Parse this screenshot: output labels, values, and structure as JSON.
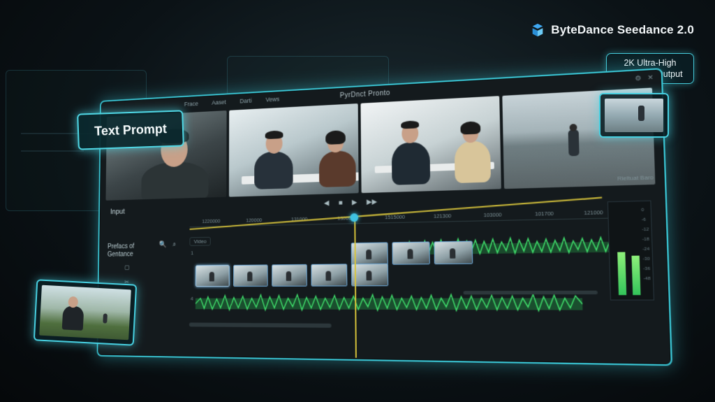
{
  "brand": {
    "name": "ByteDance Seedance 2.0",
    "icon": "seedance-logo-icon"
  },
  "badge": {
    "line1": "2K Ultra-High",
    "line2": "Definition Output"
  },
  "editor": {
    "title": "PyrDnct Pronto",
    "menu": [
      "Frace",
      "Aaset",
      "Darti",
      "Vews"
    ],
    "input_label": "Input",
    "preface_label": "Prefacs of",
    "preface_sub": "Gentance",
    "preview_label": "Rieltuat Baro",
    "ruler_ticks": [
      "1220000",
      "120000",
      "131000",
      "130000",
      "1515000",
      "121300",
      "103000",
      "101700",
      "121000"
    ],
    "track_header": "Video",
    "track_numbers": [
      "1",
      "4"
    ],
    "controls": [
      "◀",
      "■",
      "▶",
      "▶▶"
    ],
    "tools": [
      "🔍",
      "⌕"
    ],
    "meter_marks": [
      "0",
      "-6",
      "-12",
      "-18",
      "-24",
      "-30",
      "-36",
      "-48"
    ],
    "meter_levels": {
      "left": 0.42,
      "right": 0.38
    }
  },
  "text_prompt": {
    "label": "Text Prompt"
  },
  "colors": {
    "accent": "#45c9d8",
    "waveform": "#33c45a",
    "playhead": "#d8c43a"
  }
}
